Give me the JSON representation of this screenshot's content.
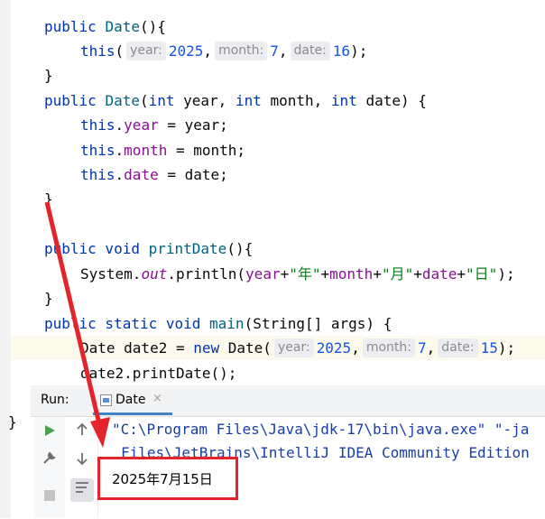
{
  "code": {
    "l1": {
      "kw": "public",
      "fn": "Date",
      "rest": "(){"
    },
    "l2": {
      "kw": "this",
      "p1": "(",
      "h_year": "year:",
      "v_year": "2025",
      "c1": ",",
      "h_month": "month:",
      "v_month": "7",
      "c2": ",",
      "h_date": "date:",
      "v_date": "16",
      "end": ");"
    },
    "l3": "}",
    "l4": {
      "kw": "public",
      "fn": "Date",
      "p": "(",
      "t1": "int",
      "a1": " year, ",
      "t2": "int",
      "a2": " month, ",
      "t3": "int",
      "a3": " date) {"
    },
    "l5": {
      "kw": "this",
      "dot": ".",
      "fld": "year",
      "rest": " = year;"
    },
    "l6": {
      "kw": "this",
      "dot": ".",
      "fld": "month",
      "rest": " = month;"
    },
    "l7": {
      "kw": "this",
      "dot": ".",
      "fld": "date",
      "rest": " = date;"
    },
    "l8": "}",
    "l9": {
      "kw": "public void",
      "fn": "printDate",
      "rest": "(){"
    },
    "l10": {
      "a": "System.",
      "out": "out",
      "b": ".println(",
      "f1": "year",
      "p1": "+",
      "s1": "\"年\"",
      "p2": "+",
      "f2": "month",
      "p3": "+",
      "s2": "\"月\"",
      "p4": "+",
      "f3": "date",
      "p5": "+",
      "s3": "\"日\"",
      "end": ");"
    },
    "l11": "}",
    "l12": {
      "kw": "public static void",
      "fn": "main",
      "rest": "(String[] args) {"
    },
    "l13": {
      "a": "Date date2 = ",
      "kw": "new",
      "b": " Date(",
      "h_year": "year:",
      "v_year": "2025",
      "c1": ",",
      "h_month": "month:",
      "v_month": "7",
      "c2": ",",
      "h_date": "date:",
      "v_date": "15",
      "end": ");"
    },
    "l14": "date2.printDate();",
    "l15": "}"
  },
  "run": {
    "title": "Run:",
    "tab_label": "Date",
    "tab_close": "×",
    "line1": "\"C:\\Program Files\\Java\\jdk-17\\bin\\java.exe\" \"-ja",
    "line2": "Files\\JetBrains\\IntelliJ IDEA Community Edition",
    "result": "2025年7月15日"
  },
  "colors": {
    "annotation_red": "#e3242b",
    "keyword": "#0033b3",
    "number": "#1750eb",
    "string": "#067d17",
    "field": "#871094"
  }
}
